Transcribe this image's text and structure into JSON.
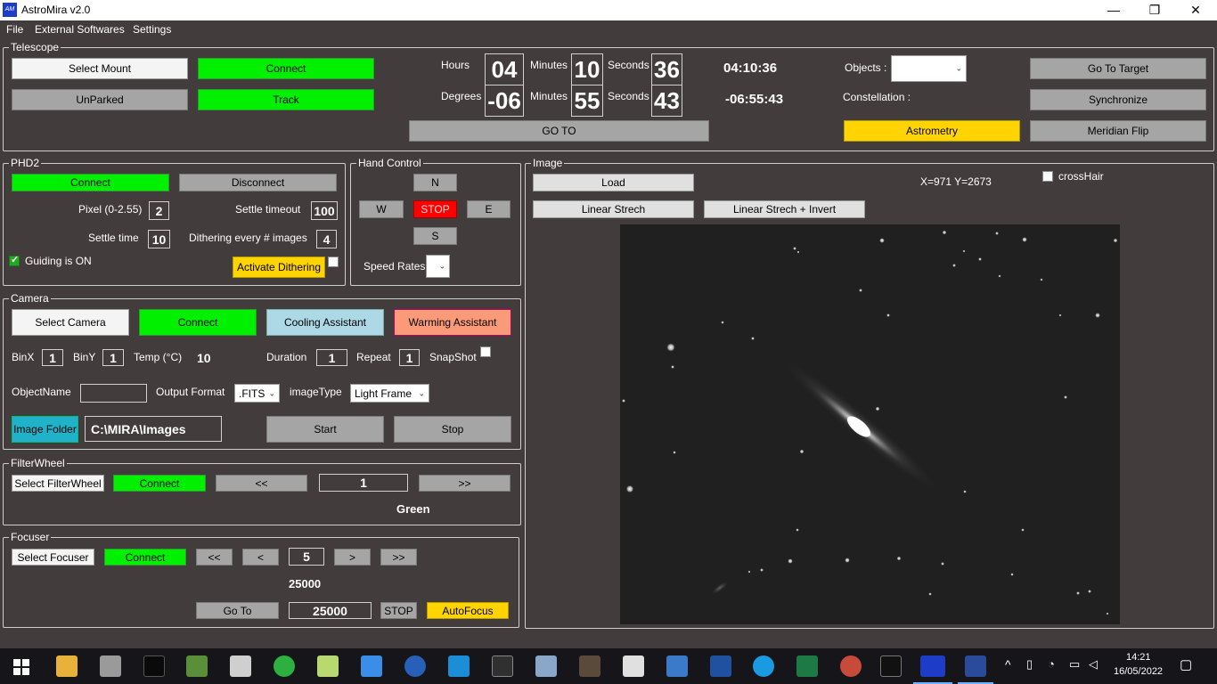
{
  "window": {
    "title": "AstroMira v2.0",
    "logo_text": "AM"
  },
  "menu": [
    "File",
    "External Softwares",
    "Settings"
  ],
  "telescope": {
    "group_title": "Telescope",
    "select_mount": "Select Mount",
    "connect": "Connect",
    "unparked": "UnParked",
    "track": "Track",
    "hours_label": "Hours",
    "hours": "04",
    "minutes_label": "Minutes",
    "minutes": "10",
    "seconds_label": "Seconds",
    "seconds": "36",
    "ra": "04:10:36",
    "degrees_label": "Degrees",
    "degrees": "-06",
    "dec_minutes": "55",
    "dec_seconds": "43",
    "dec": "-06:55:43",
    "goto": "GO TO",
    "objects_label": "Objects :",
    "constellation_label": "Constellation :",
    "go_to_target": "Go To Target",
    "synchronize": "Synchronize",
    "astrometry": "Astrometry",
    "meridian_flip": "Meridian Flip"
  },
  "phd2": {
    "group_title": "PHD2",
    "connect": "Connect",
    "disconnect": "Disconnect",
    "pixel_label": "Pixel (0-2.55)",
    "pixel": "2",
    "settle_timeout_label": "Settle timeout",
    "settle_timeout": "100",
    "settle_time_label": "Settle time",
    "settle_time": "10",
    "dithering_label": "Dithering every # images",
    "dithering": "4",
    "guiding_label": "Guiding is ON",
    "activate_dithering": "Activate Dithering"
  },
  "hand_control": {
    "group_title": "Hand Control",
    "n": "N",
    "w": "W",
    "stop": "STOP",
    "e": "E",
    "s": "S",
    "speed_rates_label": "Speed Rates"
  },
  "image": {
    "group_title": "Image",
    "load": "Load",
    "linear_stretch": "Linear Strech",
    "linear_stretch_invert": "Linear Strech + Invert",
    "coords": "X=971 Y=2673",
    "crosshair_label": "crossHair"
  },
  "camera": {
    "group_title": "Camera",
    "select_camera": "Select Camera",
    "connect": "Connect",
    "cooling_assistant": "Cooling Assistant",
    "warming_assistant": "Warming Assistant",
    "binx_label": "BinX",
    "binx": "1",
    "biny_label": "BinY",
    "biny": "1",
    "temp_label": "Temp (°C)",
    "temp": "10",
    "duration_label": "Duration",
    "duration": "1",
    "repeat_label": "Repeat",
    "repeat": "1",
    "snapshot_label": "SnapShot",
    "object_name_label": "ObjectName",
    "output_format_label": "Output Format",
    "output_format": ".FITS",
    "image_type_label": "imageType",
    "image_type": "Light Frame",
    "image_folder": "Image Folder",
    "image_folder_path": "C:\\MIRA\\Images",
    "start": "Start",
    "stop": "Stop"
  },
  "filterwheel": {
    "group_title": "FilterWheel",
    "select": "Select FilterWheel",
    "connect": "Connect",
    "prev": "<<",
    "position": "1",
    "next": ">>",
    "filter_name": "Green"
  },
  "focuser": {
    "group_title": "Focuser",
    "select": "Select Focuser",
    "connect": "Connect",
    "fast_in": "<<",
    "in": "<",
    "step": "5",
    "out": ">",
    "fast_out": ">>",
    "position": "25000",
    "goto": "Go To",
    "target": "25000",
    "stop": "STOP",
    "autofocus": "AutoFocus"
  },
  "taskbar": {
    "time": "14:21",
    "date": "16/05/2022"
  }
}
